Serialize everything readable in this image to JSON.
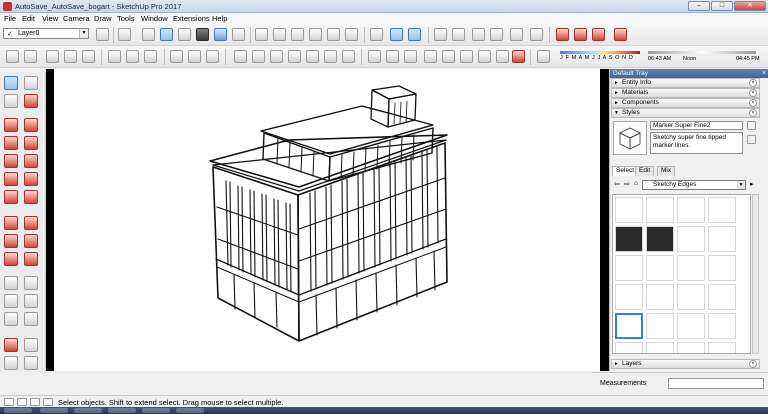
{
  "window": {
    "title": "AutoSave_AutoSave_bogart - SketchUp Pro 2017"
  },
  "menu": [
    "File",
    "Edit",
    "View",
    "Camera",
    "Draw",
    "Tools",
    "Window",
    "Extensions",
    "Help"
  ],
  "layer": {
    "check": "✓",
    "value": "Layer0"
  },
  "shadows": {
    "months": "J F M A M J J A S O N D",
    "time_start": "06:43 AM",
    "time_mid": "Noon",
    "time_end": "04:45 PM"
  },
  "tray": {
    "title": "Default Tray",
    "panels": {
      "entity_info": "Entity Info",
      "materials": "Materials",
      "components": "Components",
      "styles": "Styles",
      "layers": "Layers"
    },
    "style": {
      "name": "Marker Super Fine2",
      "description": "Sketchy super fine tipped marker lines."
    },
    "tabs": [
      "Select",
      "Edit",
      "Mix"
    ],
    "library": "Sketchy Edges"
  },
  "measurements": {
    "label": "Measurements",
    "value": ""
  },
  "status": {
    "text": "Select objects. Shift to extend select. Drag mouse to select multiple."
  }
}
